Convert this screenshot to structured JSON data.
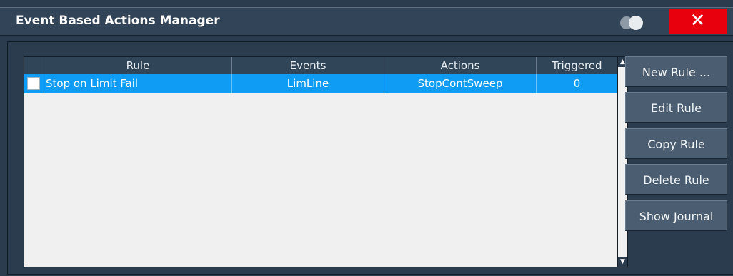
{
  "window": {
    "title": "Event Based Actions Manager",
    "close_symbol": "✕",
    "toggle_icon": "toggle-icon"
  },
  "table": {
    "headers": [
      "Rule",
      "Events",
      "Actions",
      "Triggered"
    ],
    "rows": [
      {
        "checked": false,
        "rule": "Stop on Limit Fail",
        "events": "LimLine",
        "actions": "StopContSweep",
        "triggered": "0"
      }
    ]
  },
  "buttons": [
    "New Rule ...",
    "Edit Rule",
    "Copy Rule",
    "Delete Rule",
    "Show Journal"
  ],
  "colors": {
    "selected_row": "#0f9cf5",
    "close_button": "#e8000c",
    "panel_background": "#2b3c4f"
  }
}
